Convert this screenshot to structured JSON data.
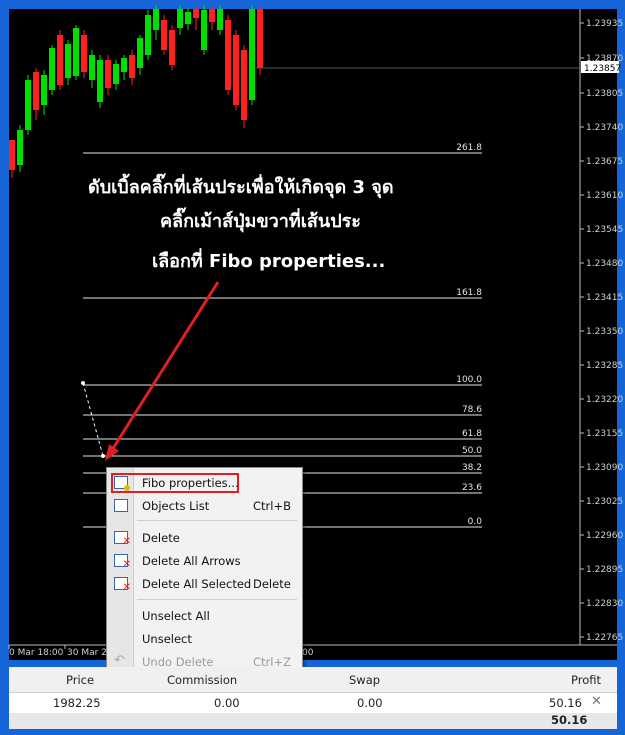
{
  "chart": {
    "price_labels": [
      "1.23935",
      "1.23870",
      "1.23805",
      "1.23740",
      "1.23675",
      "1.23610",
      "1.23545",
      "1.23480",
      "1.23415",
      "1.23350",
      "1.23285",
      "1.23220",
      "1.23155",
      "1.23090",
      "1.23025",
      "1.22960",
      "1.22895",
      "1.22830",
      "1.22765"
    ],
    "current_price": "1.23857",
    "time_labels": [
      "0 Mar 18:00",
      "30 Mar 22",
      "00"
    ],
    "fibo_levels": [
      "261.8",
      "161.8",
      "100.0",
      "78.6",
      "61.8",
      "50.0",
      "38.2",
      "23.6",
      "0.0"
    ]
  },
  "annotation": {
    "line1": "ดับเบิ้ลคลิ๊กที่เส้นประเพื่อให้เกิดจุด 3 จุด",
    "line2": "คลิ๊กเม้าส์ปุ่มขวาที่เส้นประ",
    "line3": "เลือกที่ Fibo properties...",
    "color": "#ffffff",
    "arrow_color": "#e02020"
  },
  "context_menu": {
    "fibo_properties": "Fibo properties...",
    "objects_list": "Objects List",
    "objects_list_shortcut": "Ctrl+B",
    "delete": "Delete",
    "delete_all_arrows": "Delete All Arrows",
    "delete_all_selected": "Delete All Selected",
    "delete_all_selected_shortcut": "Delete",
    "unselect_all": "Unselect All",
    "unselect": "Unselect",
    "undo_delete": "Undo Delete",
    "undo_delete_shortcut": "Ctrl+Z"
  },
  "terminal": {
    "headers": {
      "price": "Price",
      "commission": "Commission",
      "swap": "Swap",
      "profit": "Profit"
    },
    "row": {
      "price": "1982.25",
      "commission": "0.00",
      "swap": "0.00",
      "profit": "50.16"
    },
    "total_profit": "50.16"
  },
  "colors": {
    "background": "#000000",
    "bull": "#00e000",
    "bear": "#ff2020",
    "frame": "#1565d8",
    "highlight": "#e02020"
  }
}
